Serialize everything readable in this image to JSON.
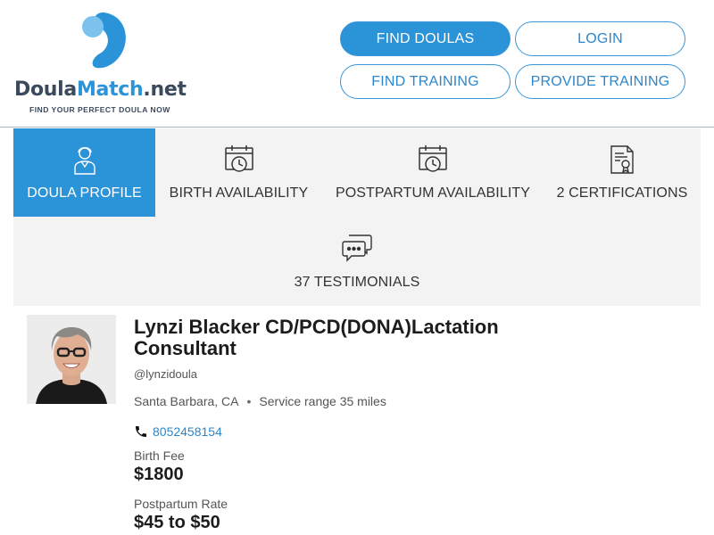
{
  "brand": {
    "name_part1": "Doula",
    "name_part2": "Match",
    "name_part3": ".net",
    "tagline": "FIND YOUR PERFECT DOULA NOW",
    "accent_color": "#2b93d8"
  },
  "nav": {
    "find_doulas": "FIND DOULAS",
    "login": "LOGIN",
    "find_training": "FIND TRAINING",
    "provide_training": "PROVIDE TRAINING"
  },
  "tabs": {
    "profile": "DOULA PROFILE",
    "birth": "BIRTH AVAILABILITY",
    "postpartum": "POSTPARTUM AVAILABILITY",
    "certifications": "2 CERTIFICATIONS",
    "testimonials": "37 TESTIMONIALS"
  },
  "profile": {
    "name": "Lynzi Blacker CD/PCD(DONA)Lactation Consultant",
    "handle": "@lynzidoula",
    "location": "Santa Barbara, CA",
    "service_range": "Service range 35 miles",
    "phone": "8052458154",
    "birth_fee_label": "Birth Fee",
    "birth_fee": "$1800",
    "postpartum_rate_label": "Postpartum Rate",
    "postpartum_rate": "$45 to $50"
  },
  "icons": {
    "profile_tab": "doula-person-icon",
    "birth_tab": "calendar-clock-icon",
    "postpartum_tab": "calendar-clock-icon",
    "certifications_tab": "certificate-icon",
    "testimonials_tab": "chat-bubbles-icon",
    "phone": "phone-icon"
  }
}
